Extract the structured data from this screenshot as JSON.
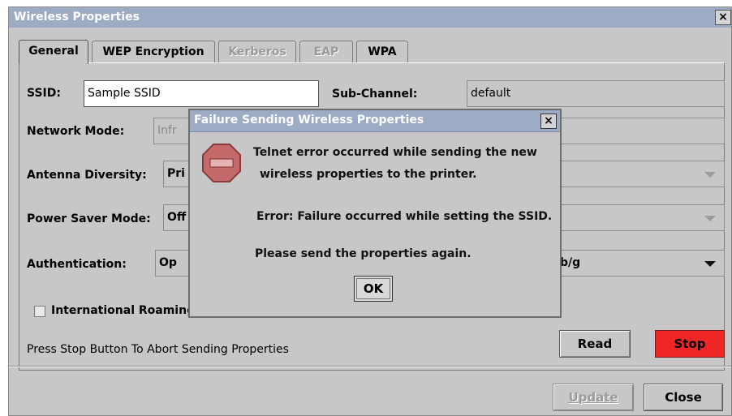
{
  "window": {
    "title": "Wireless Properties",
    "close_symbol": "×"
  },
  "tabs": [
    {
      "label": "General",
      "state": "active"
    },
    {
      "label": "WEP Encryption",
      "state": "enabled"
    },
    {
      "label": "Kerberos",
      "state": "disabled"
    },
    {
      "label": "EAP",
      "state": "disabled"
    },
    {
      "label": "WPA",
      "state": "enabled"
    }
  ],
  "form": {
    "ssid_label": "SSID:",
    "ssid_value": "Sample SSID",
    "subchannel_label": "Sub-Channel:",
    "subchannel_value": "default",
    "network_mode_label": "Network Mode:",
    "network_mode_value": "Infr",
    "antenna_label": "Antenna Diversity:",
    "antenna_value": "Pri",
    "power_saver_label": "Power Saver Mode:",
    "power_saver_value": "Off",
    "authentication_label": "Authentication:",
    "authentication_value": "Op",
    "right_combo_value": "b/g",
    "intl_roaming_label": "International Roaming",
    "intl_roaming_checked": false,
    "status_text": "Press Stop Button To Abort Sending Properties"
  },
  "buttons": {
    "read": "Read",
    "stop": "Stop",
    "update": "Update",
    "close": "Close"
  },
  "colors": {
    "titlebar": "#9eabc5",
    "stop_button": "#ef2626",
    "window_bg": "#c7c7c7"
  },
  "dialog": {
    "title": "Failure Sending Wireless Properties",
    "close_symbol": "×",
    "icon": "stop-sign-icon",
    "line1": "Telnet error occurred while sending the new",
    "line2": "wireless properties to the printer.",
    "line3": "Error: Failure occurred while setting the SSID.",
    "line4": "Please send the properties again.",
    "ok": "OK"
  }
}
